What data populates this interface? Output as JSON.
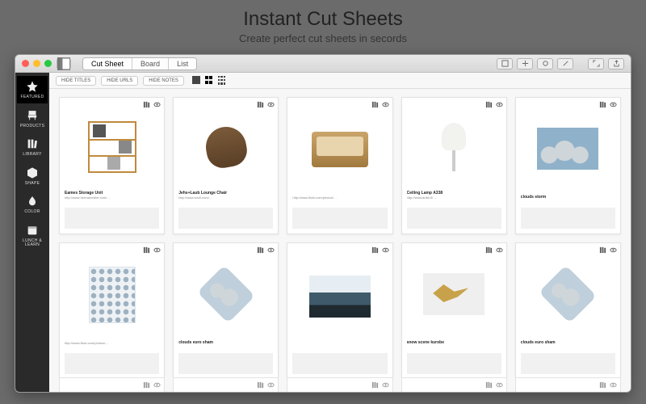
{
  "hero": {
    "title": "Instant Cut Sheets",
    "subtitle": "Create perfect cut sheets in secords"
  },
  "tabs": {
    "cut_sheet": "Cut Sheet",
    "board": "Board",
    "list": "List"
  },
  "sidebar": {
    "items": [
      {
        "label": "FEATURED"
      },
      {
        "label": "PRODUCTS"
      },
      {
        "label": "LIBRARY"
      },
      {
        "label": "SHAPE"
      },
      {
        "label": "COLOR"
      },
      {
        "label": "LUNCH & LEARN"
      }
    ]
  },
  "filters": {
    "hide_titles": "HIDE TITLES",
    "hide_urls": "HIDE URLS",
    "hide_notes": "HIDE NOTES"
  },
  "cards": [
    {
      "title": "Eames Storage Unit",
      "url": "http://www.hermanmiller.com/…"
    },
    {
      "title": "Jehs+Laub Lounge Chair",
      "url": "http://www.knoll.com/…"
    },
    {
      "title": "",
      "url": "http://www.flickr.com/photos/…"
    },
    {
      "title": "Ceiling Lamp A338",
      "url": "http://www.artek.fi/…"
    },
    {
      "title": "clouds storm",
      "url": ""
    },
    {
      "title": "",
      "url": "http://www.flickr.com/photos/…"
    },
    {
      "title": "clouds euro sham",
      "url": ""
    },
    {
      "title": "",
      "url": ""
    },
    {
      "title": "snow scene kurobe",
      "url": ""
    },
    {
      "title": "clouds euro sham",
      "url": ""
    }
  ]
}
